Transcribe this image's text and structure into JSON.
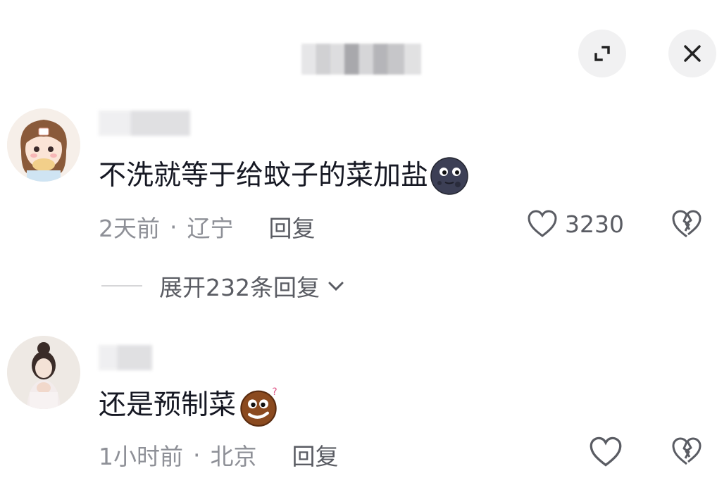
{
  "header": {
    "title_redacted": true
  },
  "comments": [
    {
      "text": "不洗就等于给蚊子的菜加盐",
      "emoji": "new-moon-face-emoji",
      "time": "2天前",
      "location": "辽宁",
      "reply_label": "回复",
      "like_count": "3230",
      "expand_replies_label": "展开232条回复"
    },
    {
      "text": "还是预制菜",
      "emoji": "confused-cookie-emoji",
      "time": "1小时前",
      "location": "北京",
      "reply_label": "回复",
      "like_count": ""
    }
  ],
  "separator_dot": "·",
  "colors": {
    "text": "#161823",
    "meta": "#8e9097",
    "button_bg": "#f1f1f2"
  }
}
